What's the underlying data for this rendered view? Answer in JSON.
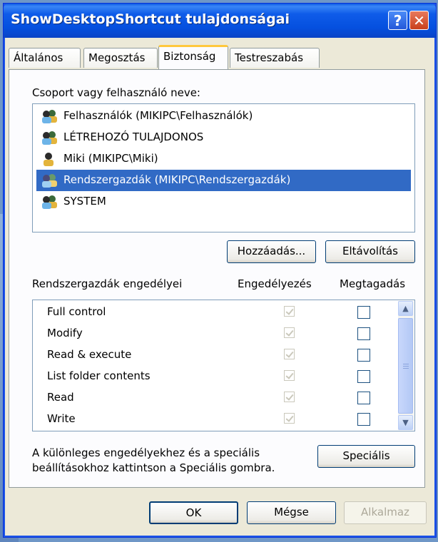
{
  "window": {
    "title": "ShowDesktopShortcut tulajdonságai",
    "help_glyph": "?",
    "close_glyph": "✕"
  },
  "tabs": [
    {
      "label": "Általános"
    },
    {
      "label": "Megosztás"
    },
    {
      "label": "Biztonság"
    },
    {
      "label": "Testreszabás"
    }
  ],
  "group_label": "Csoport vagy felhasználó neve:",
  "users": [
    {
      "name": "Felhasználók (MIKIPC\\Felhasználók)",
      "icon": "group-icon"
    },
    {
      "name": "LÉTREHOZÓ TULAJDONOS",
      "icon": "group-icon"
    },
    {
      "name": "Miki (MIKIPC\\Miki)",
      "icon": "user-icon"
    },
    {
      "name": "Rendszergazdák (MIKIPC\\Rendszergazdák)",
      "icon": "group-icon"
    },
    {
      "name": "SYSTEM",
      "icon": "group-icon"
    }
  ],
  "selected_user_index": 3,
  "buttons": {
    "add": "Hozzáadás...",
    "remove": "Eltávolítás",
    "special": "Speciális",
    "ok": "OK",
    "cancel": "Mégse",
    "apply": "Alkalmaz"
  },
  "permissions": {
    "header": "Rendszergazdák engedélyei",
    "allow_header": "Engedélyezés",
    "deny_header": "Megtagadás",
    "rows": [
      {
        "name": "Full control",
        "allow": true,
        "deny": false
      },
      {
        "name": "Modify",
        "allow": true,
        "deny": false
      },
      {
        "name": "Read & execute",
        "allow": true,
        "deny": false
      },
      {
        "name": "List folder contents",
        "allow": true,
        "deny": false
      },
      {
        "name": "Read",
        "allow": true,
        "deny": false
      },
      {
        "name": "Write",
        "allow": true,
        "deny": false
      }
    ]
  },
  "special_note_line1": "A különleges engedélyekhez és a speciális",
  "special_note_line2": "beállításokhoz kattintson a Speciális gombra.",
  "colors": {
    "titlebar": "#0550df",
    "selection": "#316ac5",
    "active_tab_accent": "#ffc83c"
  }
}
